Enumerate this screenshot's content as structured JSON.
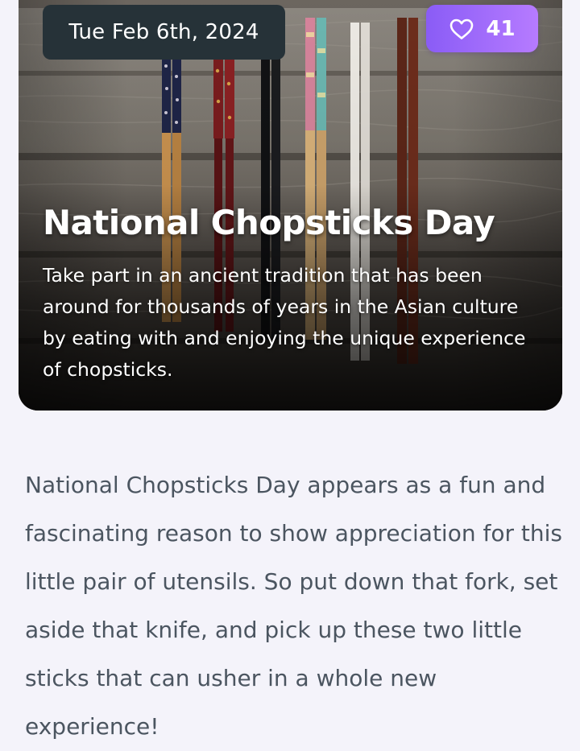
{
  "header": {
    "date": "Tue Feb 6th, 2024",
    "likes": {
      "icon": "heart-outline-icon",
      "count": "41"
    }
  },
  "hero": {
    "image": "chopsticks-on-wood-photo",
    "title": "National Chopsticks Day",
    "description": "Take part in an ancient tradition that has been around for thousands of years in the Asian culture by eating with and enjoying the unique experience of chopsticks."
  },
  "article": {
    "body": "National Chopsticks Day appears as a fun and fascinating reason to show appreciation for this little pair of utensils. So put down that fork, set aside that knife, and pick up these two little sticks that can usher in a whole new experience!"
  },
  "colors": {
    "accent_purple": "#8a5cf6",
    "date_badge_bg": "#263238",
    "page_bg": "#f4f3fa",
    "body_text": "#4b5560"
  }
}
